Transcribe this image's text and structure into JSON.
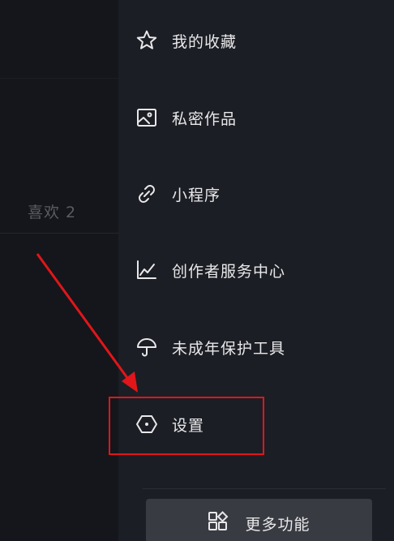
{
  "left_panel": {
    "likes_tab_label": "喜欢 2"
  },
  "drawer": {
    "items": [
      {
        "label": "我的收藏",
        "icon": "star-icon"
      },
      {
        "label": "私密作品",
        "icon": "image-icon"
      },
      {
        "label": "小程序",
        "icon": "link-icon"
      },
      {
        "label": "创作者服务中心",
        "icon": "chart-icon"
      },
      {
        "label": "未成年保护工具",
        "icon": "umbrella-icon"
      },
      {
        "label": "设置",
        "icon": "settings-hexagon-icon"
      }
    ],
    "more_button_label": "更多功能",
    "more_button_icon": "grid-apps-icon"
  },
  "annotation": {
    "highlight_color": "#e0161a",
    "highlighted_item": "设置"
  },
  "colors": {
    "background": "#15171c",
    "drawer": "#1c1e25",
    "text": "#e8e8ea",
    "muted_text": "#5a5c62",
    "button": "#393b42"
  }
}
